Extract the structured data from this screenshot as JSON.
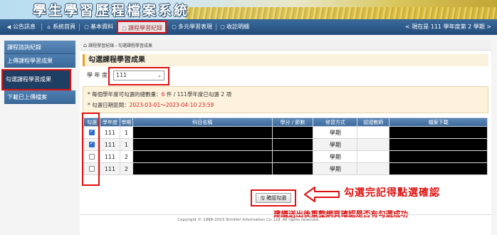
{
  "header": {
    "title": "學生學習歷程檔案系統"
  },
  "nav": {
    "items": [
      {
        "icon": "announce-icon",
        "glyph": "◀",
        "label": "公告訊息"
      },
      {
        "icon": "home-icon",
        "glyph": "⌂",
        "label": "系統首頁"
      },
      {
        "icon": "doc-icon",
        "glyph": "▢",
        "label": "基本資料"
      },
      {
        "icon": "doc-icon",
        "glyph": "▢",
        "label": "課程學習紀錄"
      },
      {
        "icon": "doc-icon",
        "glyph": "▢",
        "label": "多元學習表現"
      },
      {
        "icon": "doc-icon",
        "glyph": "▢",
        "label": "收訖明細"
      }
    ],
    "status": "< 現在是 111 學年度第 2 學期 >"
  },
  "sidebar": {
    "items": [
      {
        "label": "課程諮詢紀錄"
      },
      {
        "label": "上傳課程學習成果"
      },
      {
        "label": "勾選課程學習成果"
      },
      {
        "label": "下載已上傳檔案"
      }
    ]
  },
  "breadcrumb": "課程學習紀錄 - 勾選課程學習成果",
  "section_title": "勾選課程學習成果",
  "year": {
    "label": "學 年 度",
    "value": "111",
    "arrow": "⌄"
  },
  "notice": {
    "line1_prefix": "* 每個學年度可勾選的總數量：",
    "line1_count": "6",
    "line1_suffix": " 件 / 111學年度已勾選 2 項",
    "line2_prefix": "* 勾選日期區間：",
    "line2_dates": "2023-03-01～2023-04-10 23:59"
  },
  "table": {
    "headers": [
      "勾選",
      "學年度",
      "學期",
      "科目名稱",
      "學分 / 節數",
      "修習方式",
      "認證教師",
      "檔案下載"
    ],
    "rows": [
      {
        "checked": true,
        "year": "111",
        "term": "1",
        "mode": "學期"
      },
      {
        "checked": true,
        "year": "111",
        "term": "1",
        "mode": "學期"
      },
      {
        "checked": false,
        "year": "111",
        "term": "2",
        "mode": "學期"
      },
      {
        "checked": false,
        "year": "111",
        "term": "2",
        "mode": "學期"
      }
    ]
  },
  "confirm_button": {
    "icon": "save-icon",
    "glyph": "🖫",
    "label": "確認勾選"
  },
  "annotations": {
    "main": "勾選完記得點選確認",
    "sub": "建議送出後重整網頁確認是否有勾選成功"
  },
  "footer": "Copyright © 1988-2023 ShinHer Information Co.,Ltd. All rights reserved.",
  "colors": {
    "nav": "#224c7a",
    "highlight": "#e01010",
    "accent": "#e7a21c"
  }
}
